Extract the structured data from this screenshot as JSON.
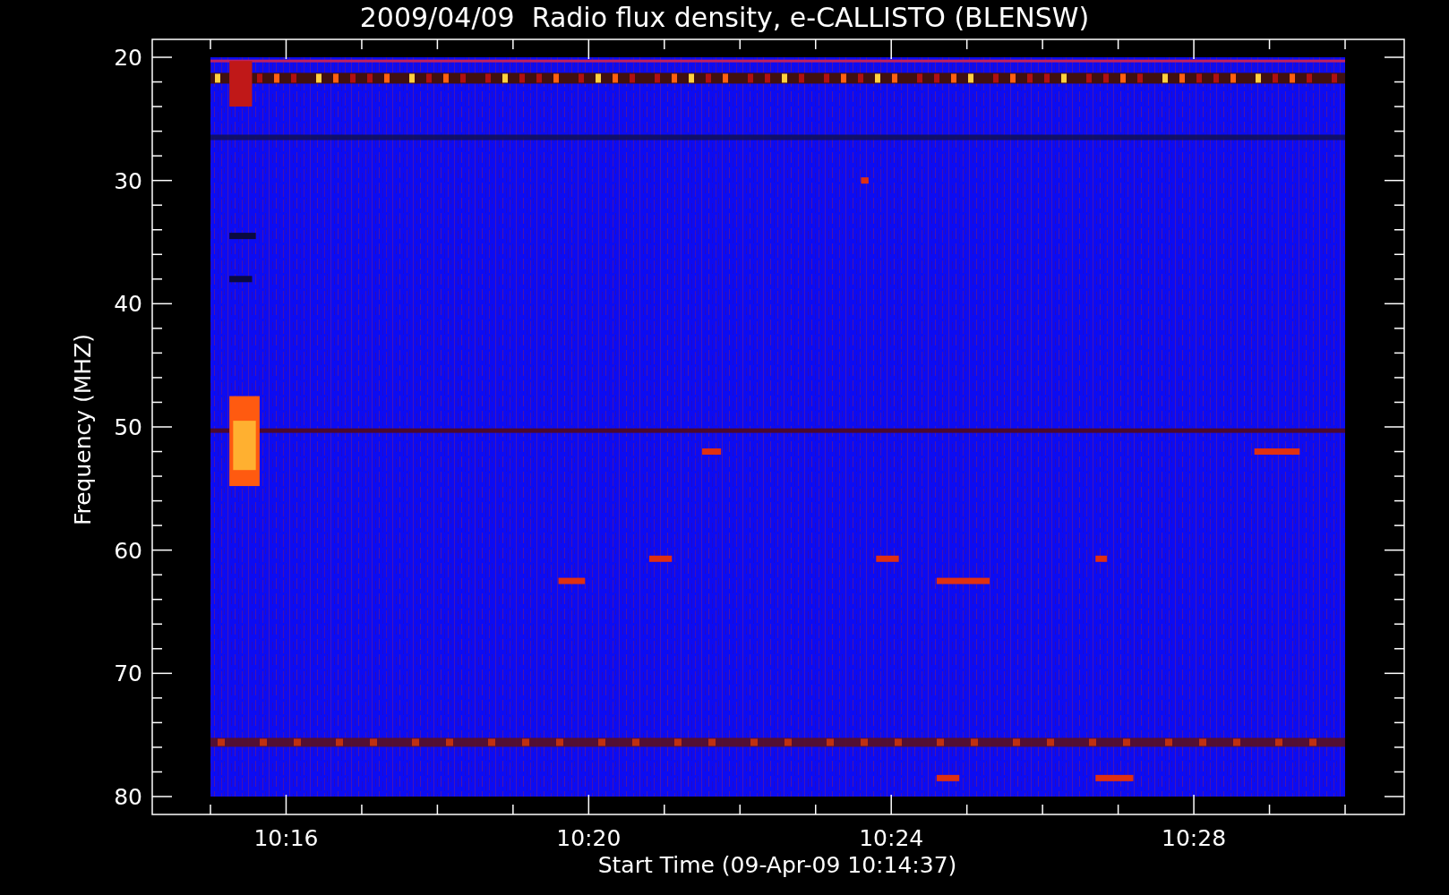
{
  "title": "2009/04/09  Radio flux density, e-CALLISTO (BLENSW)",
  "y_axis": {
    "label": "Frequency (MHZ)",
    "ticks": [
      "20",
      "30",
      "40",
      "50",
      "60",
      "70",
      "80"
    ]
  },
  "x_axis": {
    "label": "Start Time (09-Apr-09 10:14:37)",
    "ticks": [
      "10:16",
      "10:20",
      "10:24",
      "10:28"
    ]
  }
}
